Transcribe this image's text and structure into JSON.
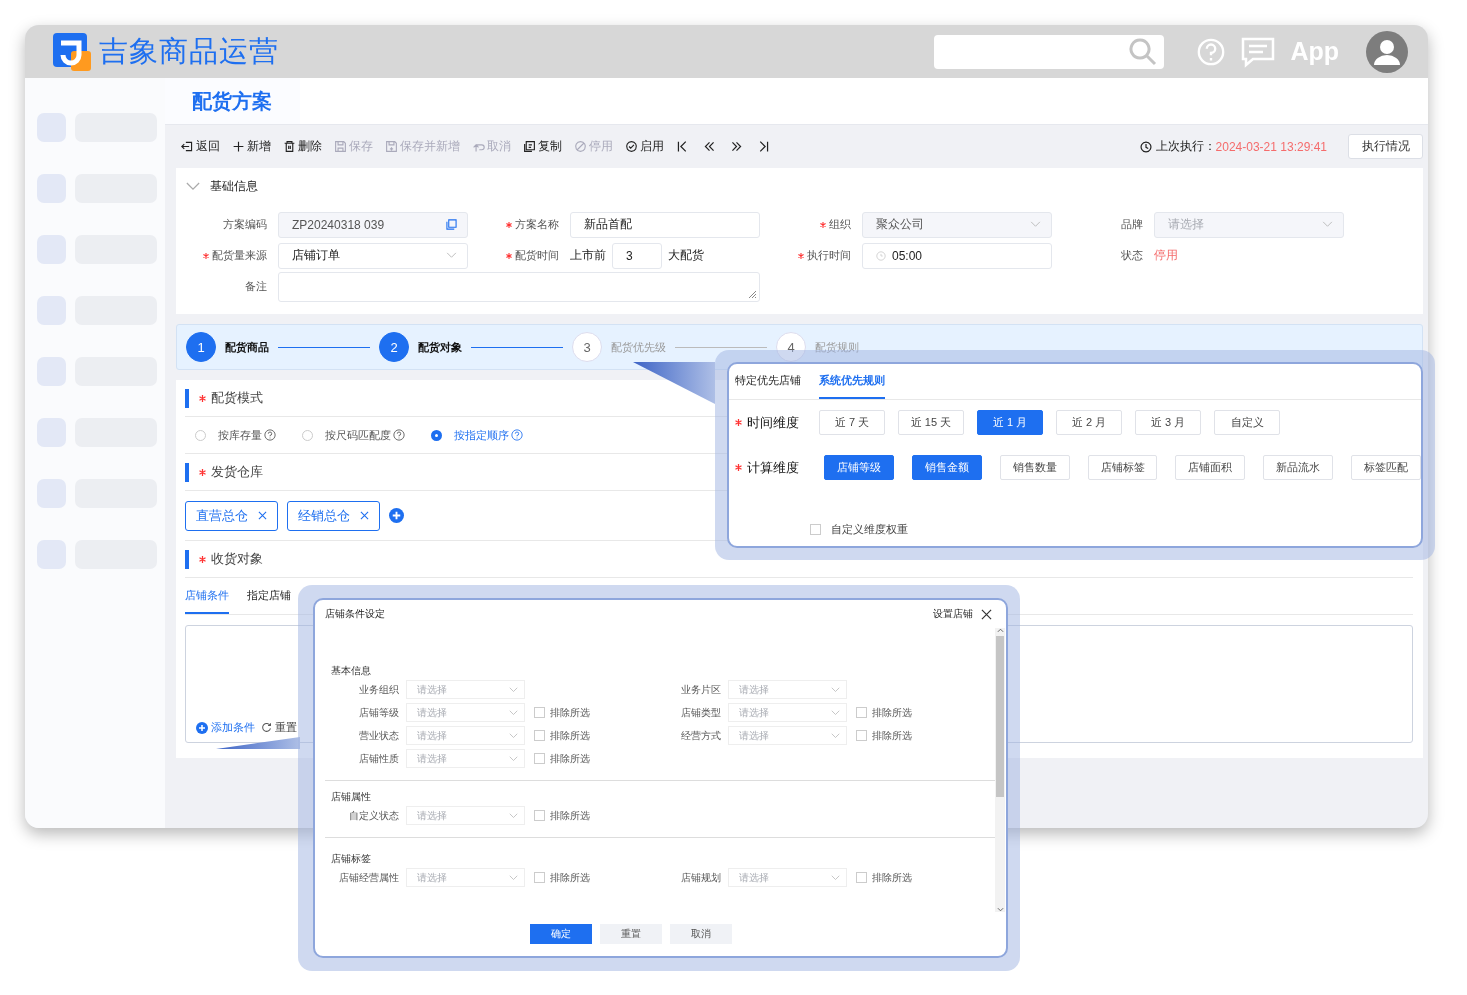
{
  "header": {
    "app_name": "吉象商品运营",
    "app_link": "App"
  },
  "page_tabs": [
    {
      "label": "配货方案",
      "selected": true
    }
  ],
  "toolbar": {
    "actions": [
      {
        "kind": "back",
        "label": "返回",
        "disabled": false
      },
      {
        "kind": "add",
        "label": "新增",
        "disabled": false
      },
      {
        "kind": "delete",
        "label": "删除",
        "disabled": false
      },
      {
        "kind": "save",
        "label": "保存",
        "disabled": true
      },
      {
        "kind": "save_new",
        "label": "保存并新增",
        "disabled": true
      },
      {
        "kind": "cancel",
        "label": "取消",
        "disabled": true
      },
      {
        "kind": "copy",
        "label": "复制",
        "disabled": false
      },
      {
        "kind": "disable",
        "label": "停用",
        "disabled": true
      },
      {
        "kind": "enable",
        "label": "启用",
        "disabled": false
      }
    ],
    "nav": [
      {
        "kind": "first"
      },
      {
        "kind": "prev"
      },
      {
        "kind": "next"
      },
      {
        "kind": "last"
      }
    ],
    "last_run_label": "上次执行：",
    "last_run": "2024-03-21 13:29:41",
    "run_status_button": "执行情况"
  },
  "basic_info": {
    "title": "基础信息",
    "expanded": true,
    "fields": [
      {
        "kind": "readonly",
        "label": "方案编码",
        "required": false,
        "value": "ZP20240318 039"
      },
      {
        "kind": "text",
        "label": "方案名称",
        "required": true,
        "value": "新品首配"
      },
      {
        "kind": "select",
        "label": "组织",
        "required": true,
        "value": "聚众公司",
        "disabled": true
      },
      {
        "kind": "select",
        "label": "品牌",
        "required": false,
        "placeholder": "请选择",
        "disabled": true
      },
      {
        "kind": "select",
        "label": "配货量来源",
        "required": true,
        "value": "店铺订单",
        "disabled": false
      },
      {
        "kind": "days",
        "label": "配货时间",
        "required": true,
        "prefix": "上市前",
        "value": "3",
        "suffix": "大配货"
      },
      {
        "kind": "time",
        "label": "执行时间",
        "required": true,
        "value": "05:00"
      },
      {
        "kind": "status",
        "label": "状态",
        "required": false,
        "value": "停用"
      },
      {
        "kind": "textarea",
        "label": "备注",
        "required": false
      }
    ]
  },
  "steps": [
    {
      "number": "1",
      "label": "配货商品",
      "active": true
    },
    {
      "number": "2",
      "label": "配货对象",
      "active": true
    },
    {
      "number": "3",
      "label": "配货优先级",
      "active": false
    },
    {
      "number": "4",
      "label": "配货规则",
      "active": false
    }
  ],
  "mode": {
    "title": "配货模式",
    "required": true,
    "options": [
      {
        "label": "按库存量",
        "selected": false
      },
      {
        "label": "按尺码匹配度",
        "selected": false
      },
      {
        "label": "按指定顺序",
        "selected": true
      }
    ]
  },
  "warehouse": {
    "title": "发货仓库",
    "required": true,
    "tags": [
      "直营总仓",
      "经销总仓"
    ]
  },
  "receivers": {
    "title": "收货对象",
    "required": true,
    "tabs": [
      {
        "label": "店铺条件",
        "selected": true
      },
      {
        "label": "指定店铺",
        "selected": false
      }
    ],
    "actions": [
      {
        "kind": "add",
        "label": "添加条件"
      },
      {
        "kind": "reset",
        "label": "重置"
      }
    ]
  },
  "priority_popup": {
    "tabs": [
      {
        "label": "特定优先店铺",
        "selected": false
      },
      {
        "label": "系统优先规则",
        "selected": true
      }
    ],
    "rows": [
      {
        "label": "时间维度",
        "required": true,
        "options": [
          {
            "label": "近 7 天",
            "selected": false
          },
          {
            "label": "近 15 天",
            "selected": false
          },
          {
            "label": "近 1 月",
            "selected": true
          },
          {
            "label": "近 2 月",
            "selected": false
          },
          {
            "label": "近 3 月",
            "selected": false
          },
          {
            "label": "自定义",
            "selected": false
          }
        ]
      },
      {
        "label": "计算维度",
        "required": true,
        "options": [
          {
            "label": "店铺等级",
            "selected": true
          },
          {
            "label": "销售金额",
            "selected": true
          },
          {
            "label": "销售数量",
            "selected": false
          },
          {
            "label": "店铺标签",
            "selected": false
          },
          {
            "label": "店铺面积",
            "selected": false
          },
          {
            "label": "新品流水",
            "selected": false
          },
          {
            "label": "标签匹配",
            "selected": false
          }
        ]
      }
    ],
    "custom_weight": {
      "label": "自定义维度权重",
      "checked": false
    }
  },
  "condition_dialog": {
    "title": "店铺条件设定",
    "link": "设置店铺",
    "groups": [
      {
        "title": "基本信息",
        "fields": [
          {
            "label": "业务组织",
            "placeholder": "请选择"
          },
          {
            "label": "业务片区",
            "placeholder": "请选择"
          },
          {
            "label": "店铺等级",
            "placeholder": "请选择",
            "exclude": {
              "label": "排除所选",
              "checked": false
            }
          },
          {
            "label": "店铺类型",
            "placeholder": "请选择",
            "exclude": {
              "label": "排除所选",
              "checked": false
            }
          },
          {
            "label": "营业状态",
            "placeholder": "请选择",
            "exclude": {
              "label": "排除所选",
              "checked": false
            }
          },
          {
            "label": "经营方式",
            "placeholder": "请选择",
            "exclude": {
              "label": "排除所选",
              "checked": false
            }
          },
          {
            "label": "店铺性质",
            "placeholder": "请选择",
            "exclude": {
              "label": "排除所选",
              "checked": false
            }
          }
        ]
      },
      {
        "title": "店铺属性",
        "fields": [
          {
            "label": "自定义状态",
            "placeholder": "请选择",
            "exclude": {
              "label": "排除所选",
              "checked": false
            }
          }
        ]
      },
      {
        "title": "店铺标签",
        "fields": [
          {
            "label": "店铺经营属性",
            "placeholder": "请选择",
            "exclude": {
              "label": "排除所选",
              "checked": false
            }
          },
          {
            "label": "店铺规划",
            "placeholder": "请选择",
            "exclude": {
              "label": "排除所选",
              "checked": false
            }
          }
        ]
      }
    ],
    "buttons": [
      {
        "kind": "primary",
        "label": "确定"
      },
      {
        "kind": "default",
        "label": "重置"
      },
      {
        "kind": "default",
        "label": "取消"
      }
    ]
  }
}
